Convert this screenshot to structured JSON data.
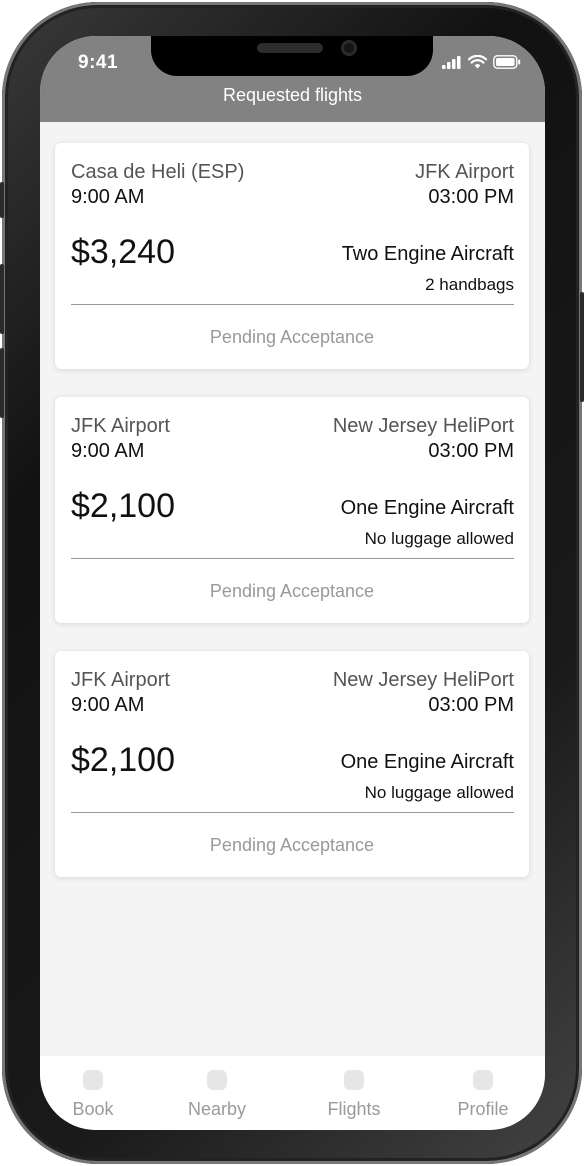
{
  "status_bar": {
    "time": "9:41"
  },
  "header": {
    "title": "Requested flights"
  },
  "flights": [
    {
      "from": "Casa de Heli (ESP)",
      "from_time": "9:00 AM",
      "to": "JFK Airport",
      "to_time": "03:00 PM",
      "price": "$3,240",
      "aircraft": "Two Engine Aircraft",
      "luggage": "2 handbags",
      "status": "Pending Acceptance"
    },
    {
      "from": "JFK Airport",
      "from_time": "9:00 AM",
      "to": "New Jersey HeliPort",
      "to_time": "03:00 PM",
      "price": "$2,100",
      "aircraft": "One Engine Aircraft",
      "luggage": "No luggage allowed",
      "status": "Pending Acceptance"
    },
    {
      "from": "JFK Airport",
      "from_time": "9:00 AM",
      "to": "New Jersey HeliPort",
      "to_time": "03:00 PM",
      "price": "$2,100",
      "aircraft": "One Engine Aircraft",
      "luggage": "No luggage allowed",
      "status": "Pending Acceptance"
    }
  ],
  "tabbar": {
    "items": [
      {
        "label": "Book",
        "icon": "book-icon"
      },
      {
        "label": "Nearby",
        "icon": "nearby-icon"
      },
      {
        "label": "Flights",
        "icon": "flights-icon"
      },
      {
        "label": "Profile",
        "icon": "profile-icon"
      }
    ]
  },
  "colors": {
    "header": "#828282",
    "background": "#f4f4f4",
    "card": "#ffffff",
    "status_text": "#999999"
  }
}
